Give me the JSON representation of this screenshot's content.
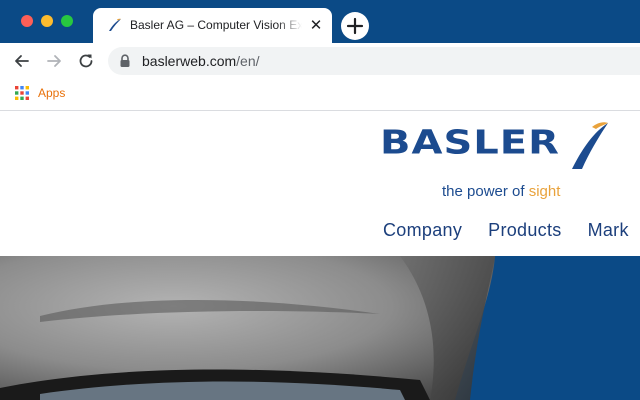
{
  "browser": {
    "tab": {
      "title": "Basler AG – Computer Vision Experts",
      "close_glyph": "✕",
      "favicon": "basler-swoosh-icon"
    },
    "new_tab_icon": "plus-icon",
    "toolbar": {
      "back_icon": "arrow-left-icon",
      "forward_icon": "arrow-right-icon",
      "reload_icon": "reload-icon",
      "lock_icon": "lock-icon",
      "url_host": "baslerweb.com",
      "url_path": "/en/"
    },
    "bookmarks": {
      "apps_label": "Apps",
      "apps_icon": "apps-grid-icon"
    }
  },
  "site": {
    "logo": {
      "wordmark": "BASLER",
      "tagline_prefix": "the power of ",
      "tagline_accent": "sight"
    },
    "nav": [
      "Company",
      "Products",
      "Mark"
    ],
    "hero": {
      "subject": "hero-photo"
    }
  },
  "colors": {
    "tabstrip": "#0b4a86",
    "brand_blue": "#1c4b8f",
    "brand_orange": "#e9a23b",
    "apps_label": "#e8710a"
  }
}
